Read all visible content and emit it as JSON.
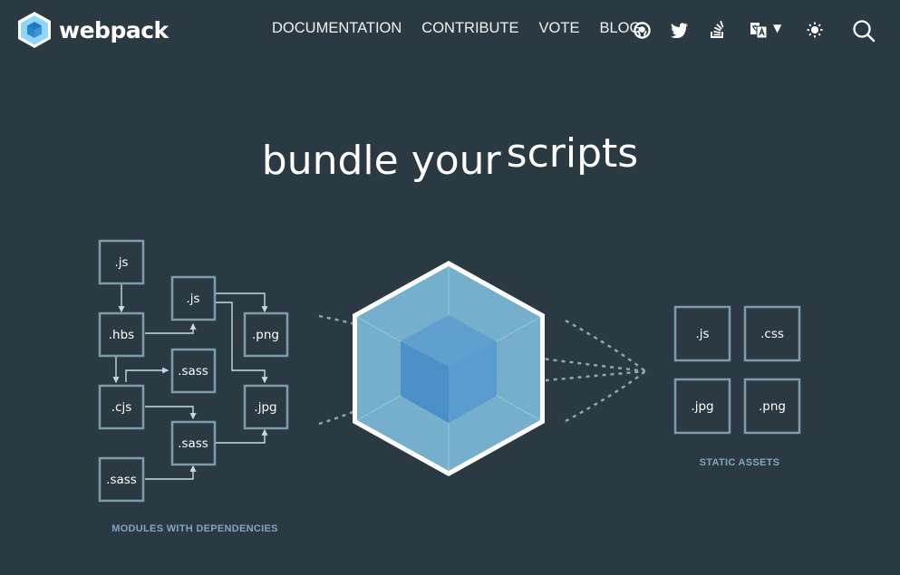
{
  "brand": {
    "name": "webpack"
  },
  "nav": {
    "links": [
      "DOCUMENTATION",
      "CONTRIBUTE",
      "VOTE",
      "BLOG"
    ]
  },
  "icons": [
    "github-icon",
    "twitter-icon",
    "stack-overflow-icon",
    "language-icon",
    "theme-toggle-icon",
    "search-icon"
  ],
  "hero": {
    "word1": "bundle your",
    "word2": "scripts"
  },
  "modules": {
    "files": [
      ".js",
      ".hbs",
      ".cjs",
      ".sass",
      ".js",
      ".sass",
      ".sass",
      ".png",
      ".jpg"
    ],
    "caption": "MODULES WITH DEPENDENCIES"
  },
  "assets": {
    "files": [
      ".js",
      ".css",
      ".jpg",
      ".png"
    ],
    "caption": "STATIC ASSETS"
  },
  "colors": {
    "background": "#2b3a42",
    "cube_outer": "#8ed6fb",
    "cube_inner": "#1c78c0",
    "box_stroke": "#7f9aa8",
    "caption": "#7fa7c0"
  }
}
